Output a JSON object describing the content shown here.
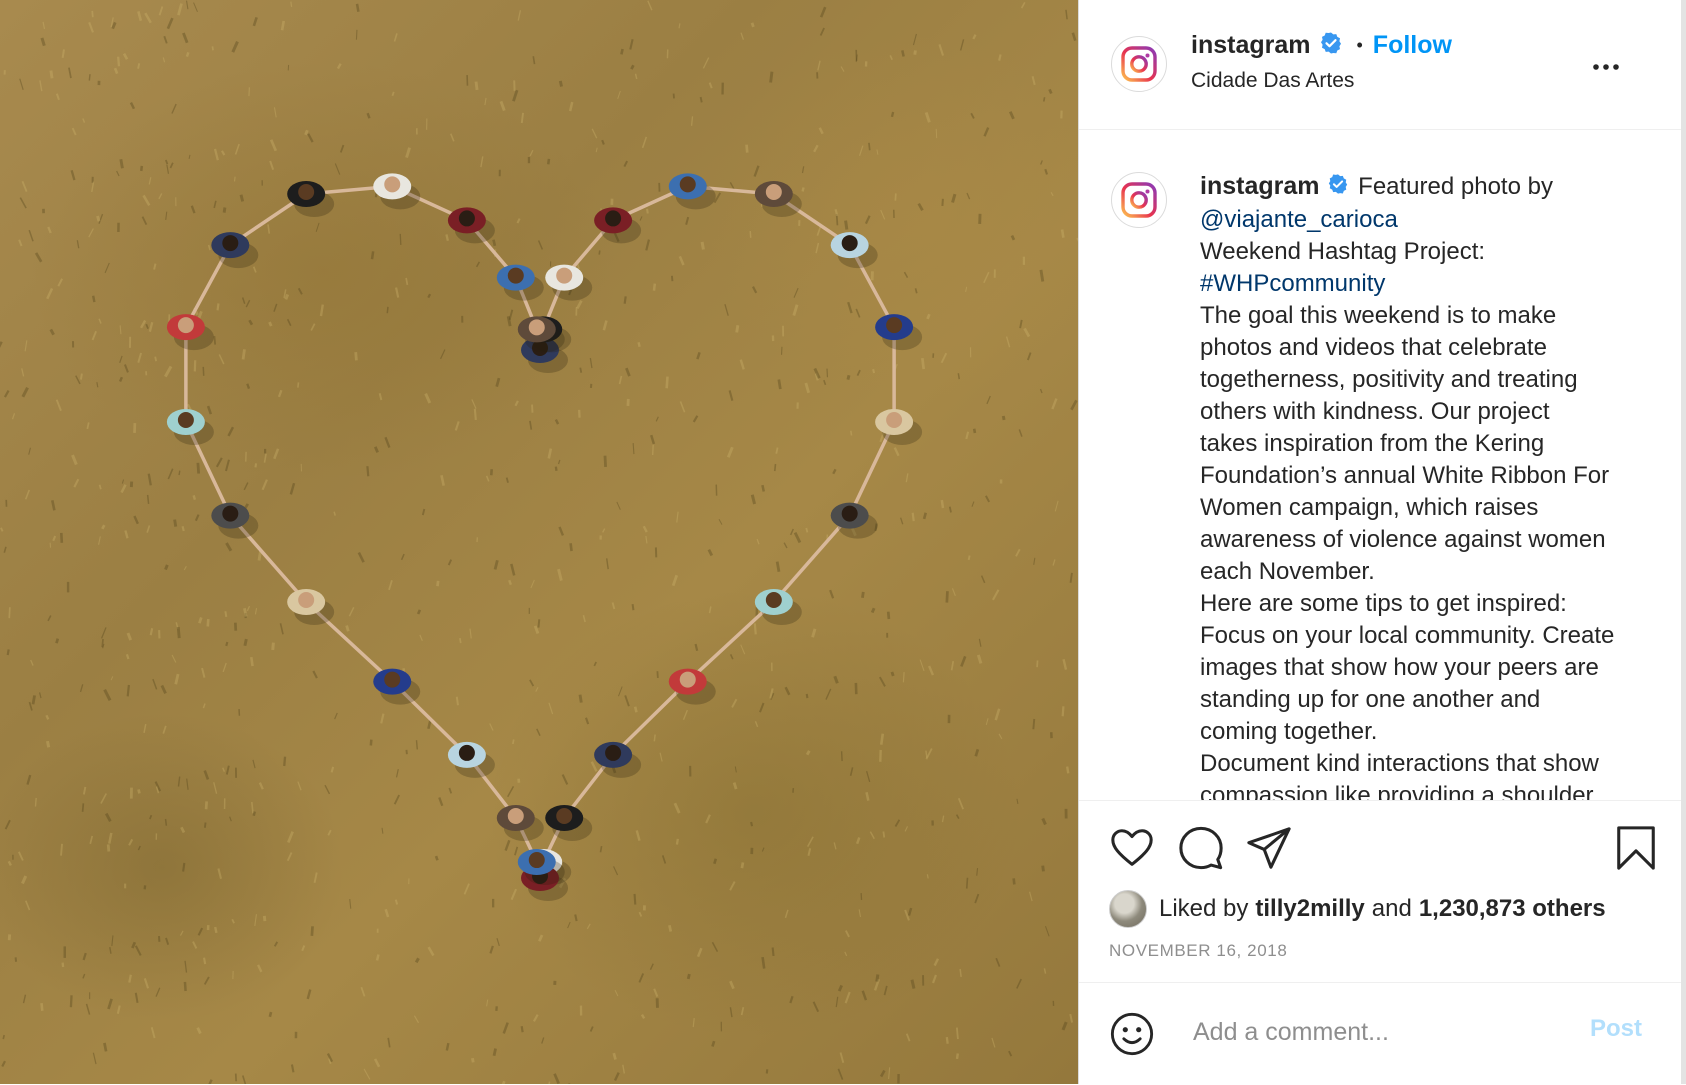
{
  "post": {
    "header": {
      "username": "instagram",
      "separator": "•",
      "follow_label": "Follow",
      "location": "Cidade Das Artes",
      "more_label": "..."
    },
    "caption": {
      "username": "instagram",
      "lines": [
        {
          "text": " Featured photo by",
          "kind": "text"
        },
        {
          "text": "@viajante_carioca",
          "kind": "link"
        },
        {
          "text": "Weekend Hashtag Project:",
          "kind": "text"
        },
        {
          "text": "#WHPcommunity",
          "kind": "link"
        },
        {
          "text": "The goal this weekend is to make",
          "kind": "text"
        },
        {
          "text": "photos and videos that celebrate",
          "kind": "text"
        },
        {
          "text": "togetherness, positivity and treating",
          "kind": "text"
        },
        {
          "text": "others with kindness. Our project",
          "kind": "text"
        },
        {
          "text": "takes inspiration from the Kering",
          "kind": "text"
        },
        {
          "text": "Foundation’s annual White Ribbon For",
          "kind": "text"
        },
        {
          "text": "Women campaign, which raises",
          "kind": "text"
        },
        {
          "text": "awareness of violence against women",
          "kind": "text"
        },
        {
          "text": "each November.",
          "kind": "text"
        },
        {
          "text": "Here are some tips to get inspired:",
          "kind": "text"
        },
        {
          "text": "Focus on your local community. Create",
          "kind": "text"
        },
        {
          "text": "images that show how your peers are",
          "kind": "text"
        },
        {
          "text": "standing up for one another and",
          "kind": "text"
        },
        {
          "text": "coming together.",
          "kind": "text"
        },
        {
          "text": "Document kind interactions that show",
          "kind": "text"
        },
        {
          "text": "compassion like providing a shoulder",
          "kind": "text"
        }
      ]
    },
    "likes": {
      "prefix": "Liked by",
      "liker": "tilly2milly",
      "conjunction": "and",
      "others": "1,230,873 others"
    },
    "date": "NOVEMBER 16, 2018",
    "comment": {
      "placeholder": "Add a comment...",
      "post_label": "Post"
    },
    "icons": {
      "like": "heart-icon",
      "comment": "comment-bubble-icon",
      "share": "paper-plane-icon",
      "save": "bookmark-icon",
      "emoji": "smiley-icon",
      "more": "more-horizontal-icon",
      "verified": "verified-badge-icon"
    },
    "colors": {
      "follow_blue": "#0095f6",
      "link_blue": "#00376b",
      "verified_blue": "#3897f0",
      "post_disabled": "#b2dffc",
      "grass": "#a88a4e"
    }
  }
}
